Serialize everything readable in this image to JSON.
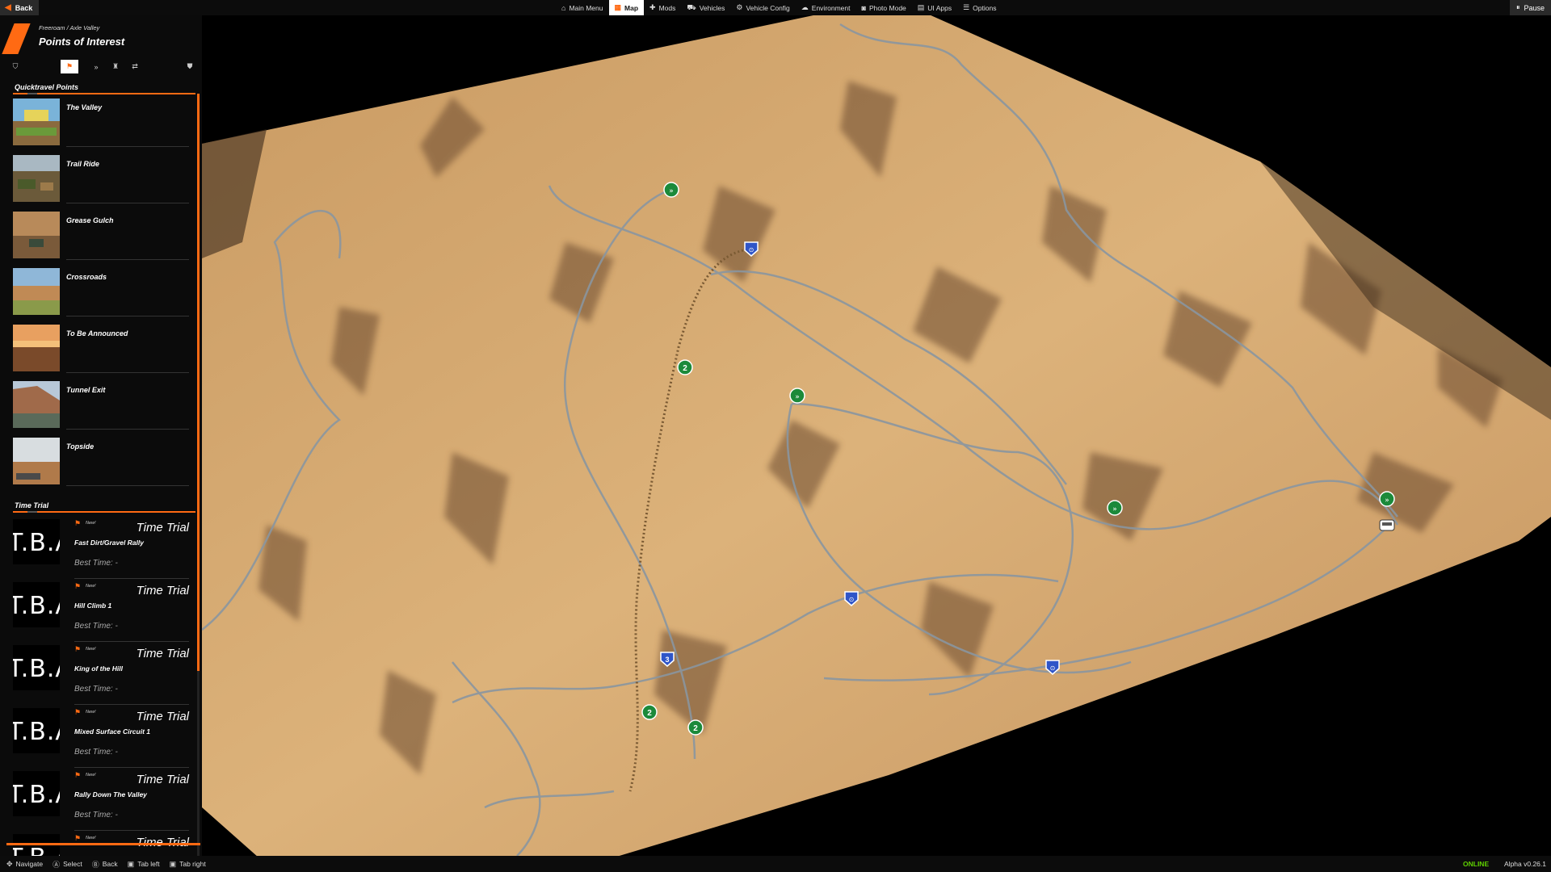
{
  "topbar": {
    "back_label": "Back",
    "pause_label": "Pause",
    "menu": [
      {
        "label": "Main Menu",
        "icon": "home-icon"
      },
      {
        "label": "Map",
        "icon": "map-icon",
        "active": true
      },
      {
        "label": "Mods",
        "icon": "puzzle-icon"
      },
      {
        "label": "Vehicles",
        "icon": "car-icon"
      },
      {
        "label": "Vehicle Config",
        "icon": "car-config-icon"
      },
      {
        "label": "Environment",
        "icon": "weather-icon"
      },
      {
        "label": "Photo Mode",
        "icon": "camera-icon"
      },
      {
        "label": "UI Apps",
        "icon": "apps-icon"
      },
      {
        "label": "Options",
        "icon": "sliders-icon"
      }
    ]
  },
  "panel": {
    "breadcrumb": "Freeroam / Axle Valley",
    "title": "Points of Interest",
    "tabs": [
      "shield-icon",
      "flag-icon",
      "chevrons-icon",
      "trophy-icon",
      "route-icon",
      "shield-badge-icon"
    ],
    "quicktravel": {
      "title": "Quicktravel Points",
      "items": [
        {
          "name": "The Valley"
        },
        {
          "name": "Trail Ride"
        },
        {
          "name": "Grease Gulch"
        },
        {
          "name": "Crossroads"
        },
        {
          "name": "To Be Announced"
        },
        {
          "name": "Tunnel Exit"
        },
        {
          "name": "Topside"
        }
      ]
    },
    "time_trial": {
      "title": "Time Trial",
      "items": [
        {
          "thumb": "T.B.A",
          "badge": "New!",
          "type": "Time Trial",
          "name": "Fast Dirt/Gravel Rally",
          "best": "Best Time: -"
        },
        {
          "thumb": "T.B.A",
          "badge": "New!",
          "type": "Time Trial",
          "name": "Hill Climb 1",
          "best": "Best Time: -"
        },
        {
          "thumb": "T.B.A",
          "badge": "New!",
          "type": "Time Trial",
          "name": "King of the Hill",
          "best": "Best Time: -"
        },
        {
          "thumb": "T.B.A",
          "badge": "New!",
          "type": "Time Trial",
          "name": "Mixed Surface Circuit 1",
          "best": "Best Time: -"
        },
        {
          "thumb": "T.B.A",
          "badge": "New!",
          "type": "Time Trial",
          "name": "Rally Down The Valley",
          "best": "Best Time: -"
        },
        {
          "thumb": "T.B.A",
          "badge": "New!",
          "type": "Time Trial",
          "name": "",
          "best": ""
        }
      ]
    }
  },
  "map": {
    "markers": [
      {
        "kind": "quicktravel",
        "label": "»"
      },
      {
        "kind": "quicktravel",
        "label": "»"
      },
      {
        "kind": "quicktravel",
        "label": "»"
      },
      {
        "kind": "quicktravel",
        "label": "»"
      },
      {
        "kind": "number",
        "label": "2"
      },
      {
        "kind": "number",
        "label": "2"
      },
      {
        "kind": "number",
        "label": "2"
      },
      {
        "kind": "shield",
        "label": "3"
      },
      {
        "kind": "shield",
        "label": "⊙"
      },
      {
        "kind": "shield",
        "label": "⊙"
      },
      {
        "kind": "shield",
        "label": "⊙"
      }
    ]
  },
  "bottombar": {
    "hints": [
      {
        "icon": "✥",
        "label": "Navigate"
      },
      {
        "icon": "Ⓐ",
        "label": "Select"
      },
      {
        "icon": "Ⓑ",
        "label": "Back"
      },
      {
        "icon": "▣",
        "label": "Tab left"
      },
      {
        "icon": "▣",
        "label": "Tab right"
      }
    ],
    "status": "ONLINE",
    "version": "Alpha v0.26.1"
  },
  "colors": {
    "accent": "#ff6a13",
    "online": "#5fd000",
    "terrain": "#d9ad73",
    "road": "#8a96a0"
  }
}
